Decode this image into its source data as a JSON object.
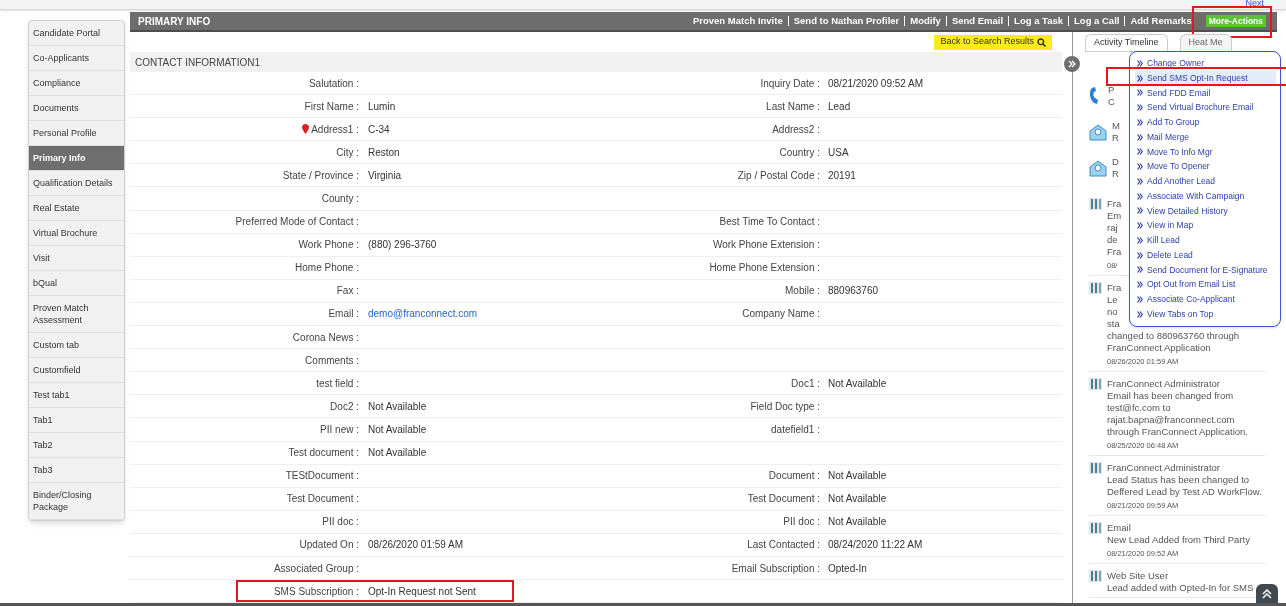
{
  "next_link": "Next",
  "sidebar": {
    "items": [
      {
        "label": "Candidate Portal",
        "selected": false
      },
      {
        "label": "Co-Applicants",
        "selected": false
      },
      {
        "label": "Compliance",
        "selected": false
      },
      {
        "label": "Documents",
        "selected": false
      },
      {
        "label": "Personal Profile",
        "selected": false
      },
      {
        "label": "Primary Info",
        "selected": true
      },
      {
        "label": "Qualification Details",
        "selected": false
      },
      {
        "label": "Real Estate",
        "selected": false
      },
      {
        "label": "Virtual Brochure",
        "selected": false
      },
      {
        "label": "Visit",
        "selected": false
      },
      {
        "label": "bQual",
        "selected": false
      },
      {
        "label": "Proven Match Assessment",
        "selected": false
      },
      {
        "label": "Custom tab",
        "selected": false
      },
      {
        "label": "Customfield",
        "selected": false
      },
      {
        "label": "Test tab1",
        "selected": false
      },
      {
        "label": "Tab1",
        "selected": false
      },
      {
        "label": "Tab2",
        "selected": false
      },
      {
        "label": "Tab3",
        "selected": false
      },
      {
        "label": "Binder/Closing Package",
        "selected": false
      }
    ]
  },
  "header": {
    "title": "PRIMARY INFO",
    "actions": [
      "Proven Match Invite",
      "Send to Nathan Profiler",
      "Modify",
      "Send Email",
      "Log a Task",
      "Log a Call",
      "Add Remarks"
    ],
    "more_actions": {
      "label": "More-Actions",
      "highlighted": true
    }
  },
  "back_button": "Back to Search Results",
  "section_title": "CONTACT INFORMATION1",
  "fields": [
    {
      "label": "Salutation :",
      "label2": "Inquiry Date :",
      "value2": "08/21/2020 09:52 AM"
    },
    {
      "label": "First Name :",
      "value": "Lumin",
      "label2": "Last Name :",
      "value2": "Lead"
    },
    {
      "label": "Address1 :",
      "value": "C-34",
      "label2": "Address2 :",
      "pin": true
    },
    {
      "label": "City :",
      "value": "Reston",
      "label2": "Country :",
      "value2": "USA"
    },
    {
      "label": "State / Province :",
      "value": "Virginia",
      "label2": "Zip / Postal Code :",
      "value2": "20191"
    },
    {
      "label": "County :"
    },
    {
      "label": "Preferred Mode of Contact :",
      "label2": "Best Time To Contact :"
    },
    {
      "label": "Work Phone :",
      "value": "(880) 296-3760",
      "label2": "Work Phone Extension :"
    },
    {
      "label": "Home Phone :",
      "label2": "Home Phone Extension :"
    },
    {
      "label": "Fax :",
      "label2": "Mobile :",
      "value2": "880963760"
    },
    {
      "label": "Email :",
      "value": "demo@franconnect.com",
      "link": true,
      "label2": "Company Name :"
    },
    {
      "label": "Corona News :"
    },
    {
      "label": "Comments :"
    },
    {
      "label": "test field :",
      "label2": "Doc1 :",
      "value2": "Not Available"
    },
    {
      "label": "Doc2 :",
      "value": "Not Available",
      "label2": "Field Doc type :"
    },
    {
      "label": "PII new :",
      "value": "Not Available",
      "label2": "datefield1 :"
    },
    {
      "label": "Test document :",
      "value": "Not Available"
    },
    {
      "label": "TEStDocument :",
      "label2": "Document :",
      "value2": "Not Available"
    },
    {
      "label": "Test Document :",
      "label2": "Test Document :",
      "value2": "Not Available"
    },
    {
      "label": "PII doc :",
      "label2": "PII doc :",
      "value2": "Not Available"
    },
    {
      "label": "Updated On :",
      "value": "08/26/2020 01:59 AM",
      "label2": "Last Contacted :",
      "value2": "08/24/2020 11:22 AM"
    },
    {
      "label": "Associated Group :",
      "label2": "Email Subscription :",
      "value2": "Opted-In"
    },
    {
      "label": "SMS Subscription :",
      "value": "Opt-In Request not Sent",
      "highlighted": true
    }
  ],
  "right_panel": {
    "tabs": [
      {
        "label": "Activity Timeline",
        "selected": true
      },
      {
        "label": "Heat Me",
        "selected": false
      }
    ],
    "timeline": [
      {
        "kind": "phone",
        "title": "P",
        "body": [
          "C"
        ]
      },
      {
        "kind": "mail",
        "title": "M",
        "body": [
          "R"
        ]
      },
      {
        "kind": "mail",
        "title": "D",
        "body": [
          "R"
        ]
      },
      {
        "kind": "note",
        "title": "Fra",
        "body": [
          "Em",
          "raj",
          "de",
          "Fra"
        ],
        "time": "08/"
      },
      {
        "kind": "note",
        "title": "Fra",
        "body": [
          "Le",
          "no",
          "sta",
          "changed to 880963760 through",
          "FranConnect Application"
        ],
        "time": "08/26/2020 01:59 AM"
      },
      {
        "kind": "note",
        "title": "FranConnect Administrator",
        "body": [
          "Email has been changed from",
          "test@fc.com to",
          "rajat.bapna@franconnect.com",
          "through FranConnect Application."
        ],
        "time": "08/25/2020 06:48 AM"
      },
      {
        "kind": "note",
        "title": "FranConnect Administrator",
        "body": [
          "Lead Status has been changed to",
          "Deffered Lead by Test AD WorkFlow."
        ],
        "time": "08/21/2020 09:59 AM"
      },
      {
        "kind": "note",
        "title": "Email",
        "body": [
          "New Lead Added from Third Party"
        ],
        "time": "08/21/2020 09:52 AM"
      },
      {
        "kind": "note",
        "title": "Web Site User",
        "body": [
          "Lead added with Opted-In for SMS"
        ]
      }
    ]
  },
  "menu": {
    "items": [
      {
        "label": "Change Owner",
        "selected": false
      },
      {
        "label": "Send SMS Opt-In Request",
        "selected": true,
        "highlighted": true
      },
      {
        "label": "Send FDD Email",
        "selected": false
      },
      {
        "label": "Send Virtual Brochure Email",
        "selected": false
      },
      {
        "label": "Add To Group",
        "selected": false
      },
      {
        "label": "Mail Merge",
        "selected": false
      },
      {
        "label": "Move To Info Mgr",
        "selected": false
      },
      {
        "label": "Move To Opener",
        "selected": false
      },
      {
        "label": "Add Another Lead",
        "selected": false
      },
      {
        "label": "Associate With Campaign",
        "selected": false
      },
      {
        "label": "View Detailed History",
        "selected": false
      },
      {
        "label": "View in Map",
        "selected": false
      },
      {
        "label": "Kill Lead",
        "selected": false
      },
      {
        "label": "Delete Lead",
        "selected": false
      },
      {
        "label": "Send Document for E-Signature",
        "selected": false
      },
      {
        "label": "Opt Out from Email List",
        "selected": false
      },
      {
        "label": "Associate Co-Applicant",
        "selected": false
      },
      {
        "label": "View Tabs on Top",
        "selected": false
      }
    ]
  }
}
